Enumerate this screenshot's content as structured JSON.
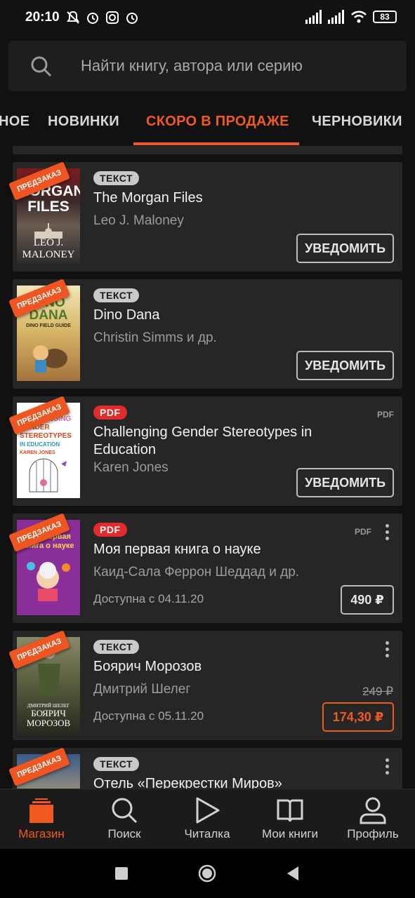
{
  "status_bar": {
    "time": "20:10",
    "battery": "83"
  },
  "search": {
    "placeholder": "Найти книгу, автора или серию"
  },
  "tabs": [
    {
      "label": "НОЕ"
    },
    {
      "label": "НОВИНКИ"
    },
    {
      "label": "СКОРО В ПРОДАЖЕ",
      "active": true
    },
    {
      "label": "ЧЕРНОВИКИ"
    }
  ],
  "colors": {
    "accent": "#f05a1e",
    "pdf_badge": "#e32b2b",
    "card_bg": "#262626"
  },
  "books": [
    {
      "ribbon": "ПРЕДЗАКАЗ",
      "badge": "ТЕКСТ",
      "title": "The Morgan Files",
      "author": "Leo J. Maloney",
      "action": "УВЕДОМИТЬ"
    },
    {
      "ribbon": "ПРЕДЗАКАЗ",
      "badge": "ТЕКСТ",
      "title": "Dino Dana",
      "author": "Christin Simms и др.",
      "action": "УВЕДОМИТЬ"
    },
    {
      "ribbon": "ПРЕДЗАКАЗ",
      "badge": "PDF",
      "format_tag": "PDF",
      "title": "Challenging Gender Stereotypes in Education",
      "author": "Karen  Jones",
      "action": "УВЕДОМИТЬ"
    },
    {
      "ribbon": "ПРЕДЗАКАЗ",
      "badge": "PDF",
      "format_tag": "PDF",
      "title": "Моя первая книга о науке",
      "author": "Каид-Сала Феррон Шеддад и др.",
      "available": "Доступна с 04.11.20",
      "price": "490 ₽"
    },
    {
      "ribbon": "ПРЕДЗАКАЗ",
      "badge": "ТЕКСТ",
      "title": "Боярич Морозов",
      "author": "Дмитрий Шелег",
      "available": "Доступна с 05.11.20",
      "old_price": "249 ₽",
      "price": "174,30 ₽"
    },
    {
      "ribbon": "ПРЕДЗАКАЗ",
      "badge": "ТЕКСТ",
      "title": "Отель «Перекрестки Миров»"
    }
  ],
  "cover_text": {
    "morgan": [
      "MORGAN",
      "FILES",
      "LEO J.",
      "MALONEY"
    ],
    "dino": [
      "DINO",
      "DANA",
      "DINO FIELD GUIDE"
    ],
    "gender": [
      "CHALLENGING",
      "GENDER",
      "STEREOTYPES",
      "IN EDUCATION",
      "KAREN JONES"
    ],
    "nauka": [
      "Моя первая",
      "книга о науке"
    ],
    "boyarich": [
      "ДМИТРИЙ ШЕЛЕГ",
      "БОЯРИЧ",
      "МОРОЗОВ"
    ]
  },
  "bottom_nav": [
    {
      "label": "Магазин",
      "icon": "shop-icon",
      "active": true
    },
    {
      "label": "Поиск",
      "icon": "search-icon"
    },
    {
      "label": "Читалка",
      "icon": "play-icon"
    },
    {
      "label": "Мои книги",
      "icon": "book-icon"
    },
    {
      "label": "Профиль",
      "icon": "profile-icon"
    }
  ]
}
